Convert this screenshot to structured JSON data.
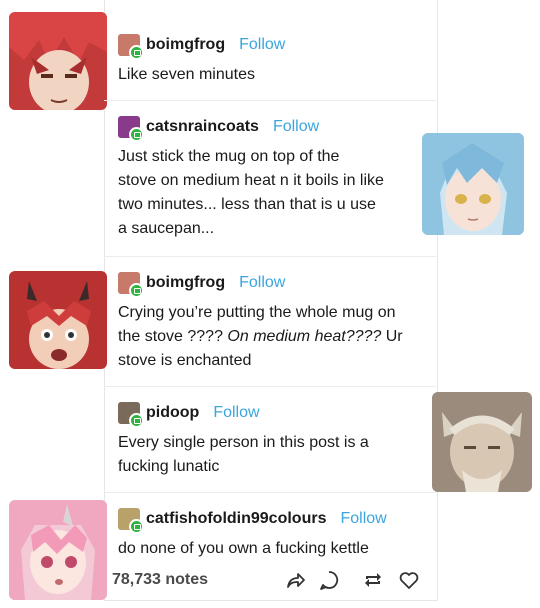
{
  "posts": [
    {
      "username": "boimgfrog",
      "follow": "Follow",
      "text": [
        "Like seven minutes"
      ]
    },
    {
      "username": "catsnraincoats",
      "follow": "Follow",
      "text": [
        "Just stick the mug on top of the",
        "stove on medium heat n it boils in like",
        "two minutes... less than that is u use",
        "a saucepan..."
      ]
    },
    {
      "username": "boimgfrog",
      "follow": "Follow",
      "text_plain_1": "Crying you’re putting the whole mug on",
      "text_plain_2": "the stove ????",
      "text_italic": "On medium heat????",
      "text_plain_3": "Ur",
      "text_plain_4": "stove is enchanted"
    },
    {
      "username": "pidoop",
      "follow": "Follow",
      "text": [
        "Every single person in this post is a",
        "fucking lunatic"
      ]
    },
    {
      "username": "catfishofoldin99colours",
      "follow": "Follow",
      "text": [
        "do none of you own a fucking kettle"
      ]
    }
  ],
  "footer": {
    "notes": "78,733 notes"
  },
  "icons": [
    "share-icon",
    "reply-icon",
    "reblog-icon",
    "like-icon"
  ],
  "colors": {
    "follow": "#3aa6dd",
    "badge": "#2fb33f"
  }
}
